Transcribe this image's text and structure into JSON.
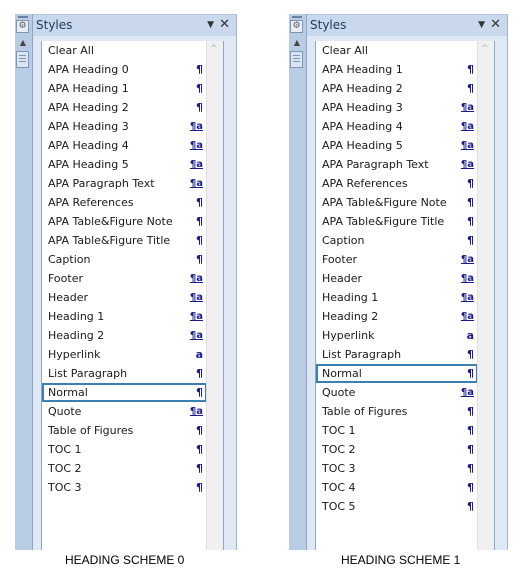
{
  "marker_glyphs": {
    "paragraph": "¶",
    "linked": "¶a",
    "character": "a"
  },
  "colors": {
    "marker": "#1b1b8f",
    "selection_border": "#3c7fb1",
    "title_bar": "#c9d8ec"
  },
  "panes": [
    {
      "title": "Styles",
      "caption": "HEADING SCHEME 0",
      "items": [
        {
          "label": "Clear All",
          "type": "none",
          "mark": ""
        },
        {
          "label": "APA Heading 0",
          "type": "paragraph",
          "mark": "¶"
        },
        {
          "label": "APA Heading 1",
          "type": "paragraph",
          "mark": "¶"
        },
        {
          "label": "APA Heading 2",
          "type": "paragraph",
          "mark": "¶"
        },
        {
          "label": "APA Heading 3",
          "type": "linked",
          "mark": "¶a"
        },
        {
          "label": "APA Heading 4",
          "type": "linked",
          "mark": "¶a"
        },
        {
          "label": "APA Heading 5",
          "type": "linked",
          "mark": "¶a"
        },
        {
          "label": "APA Paragraph Text",
          "type": "linked",
          "mark": "¶a"
        },
        {
          "label": "APA References",
          "type": "paragraph",
          "mark": "¶"
        },
        {
          "label": "APA Table&Figure Note",
          "type": "paragraph",
          "mark": "¶"
        },
        {
          "label": "APA Table&Figure Title",
          "type": "paragraph",
          "mark": "¶"
        },
        {
          "label": "Caption",
          "type": "paragraph",
          "mark": "¶"
        },
        {
          "label": "Footer",
          "type": "linked",
          "mark": "¶a"
        },
        {
          "label": "Header",
          "type": "linked",
          "mark": "¶a"
        },
        {
          "label": "Heading 1",
          "type": "linked",
          "mark": "¶a"
        },
        {
          "label": "Heading 2",
          "type": "linked",
          "mark": "¶a"
        },
        {
          "label": "Hyperlink",
          "type": "character",
          "mark": "a"
        },
        {
          "label": "List Paragraph",
          "type": "paragraph",
          "mark": "¶"
        },
        {
          "label": "Normal",
          "type": "paragraph",
          "mark": "¶",
          "selected": true
        },
        {
          "label": "Quote",
          "type": "linked",
          "mark": "¶a"
        },
        {
          "label": "Table of Figures",
          "type": "paragraph",
          "mark": "¶"
        },
        {
          "label": "TOC 1",
          "type": "paragraph",
          "mark": "¶"
        },
        {
          "label": "TOC 2",
          "type": "paragraph",
          "mark": "¶"
        },
        {
          "label": "TOC 3",
          "type": "paragraph",
          "mark": "¶"
        }
      ]
    },
    {
      "title": "Styles",
      "caption": "HEADING SCHEME 1",
      "items": [
        {
          "label": "Clear All",
          "type": "none",
          "mark": ""
        },
        {
          "label": "APA Heading 1",
          "type": "paragraph",
          "mark": "¶"
        },
        {
          "label": "APA Heading 2",
          "type": "paragraph",
          "mark": "¶"
        },
        {
          "label": "APA Heading 3",
          "type": "linked",
          "mark": "¶a"
        },
        {
          "label": "APA Heading 4",
          "type": "linked",
          "mark": "¶a"
        },
        {
          "label": "APA Heading 5",
          "type": "linked",
          "mark": "¶a"
        },
        {
          "label": "APA Paragraph Text",
          "type": "linked",
          "mark": "¶a"
        },
        {
          "label": "APA References",
          "type": "paragraph",
          "mark": "¶"
        },
        {
          "label": "APA Table&Figure Note",
          "type": "paragraph",
          "mark": "¶"
        },
        {
          "label": "APA Table&Figure Title",
          "type": "paragraph",
          "mark": "¶"
        },
        {
          "label": "Caption",
          "type": "paragraph",
          "mark": "¶"
        },
        {
          "label": "Footer",
          "type": "linked",
          "mark": "¶a"
        },
        {
          "label": "Header",
          "type": "linked",
          "mark": "¶a"
        },
        {
          "label": "Heading 1",
          "type": "linked",
          "mark": "¶a"
        },
        {
          "label": "Heading 2",
          "type": "linked",
          "mark": "¶a"
        },
        {
          "label": "Hyperlink",
          "type": "character",
          "mark": "a"
        },
        {
          "label": "List Paragraph",
          "type": "paragraph",
          "mark": "¶"
        },
        {
          "label": "Normal",
          "type": "paragraph",
          "mark": "¶",
          "selected": true
        },
        {
          "label": "Quote",
          "type": "linked",
          "mark": "¶a"
        },
        {
          "label": "Table of Figures",
          "type": "paragraph",
          "mark": "¶"
        },
        {
          "label": "TOC 1",
          "type": "paragraph",
          "mark": "¶"
        },
        {
          "label": "TOC 2",
          "type": "paragraph",
          "mark": "¶"
        },
        {
          "label": "TOC 3",
          "type": "paragraph",
          "mark": "¶"
        },
        {
          "label": "TOC 4",
          "type": "paragraph",
          "mark": "¶"
        },
        {
          "label": "TOC 5",
          "type": "paragraph",
          "mark": "¶"
        }
      ]
    }
  ],
  "icons": {
    "dropdown": "▼",
    "close": "✕",
    "scroll_up": "▲",
    "scroll_up_inner": "^"
  }
}
